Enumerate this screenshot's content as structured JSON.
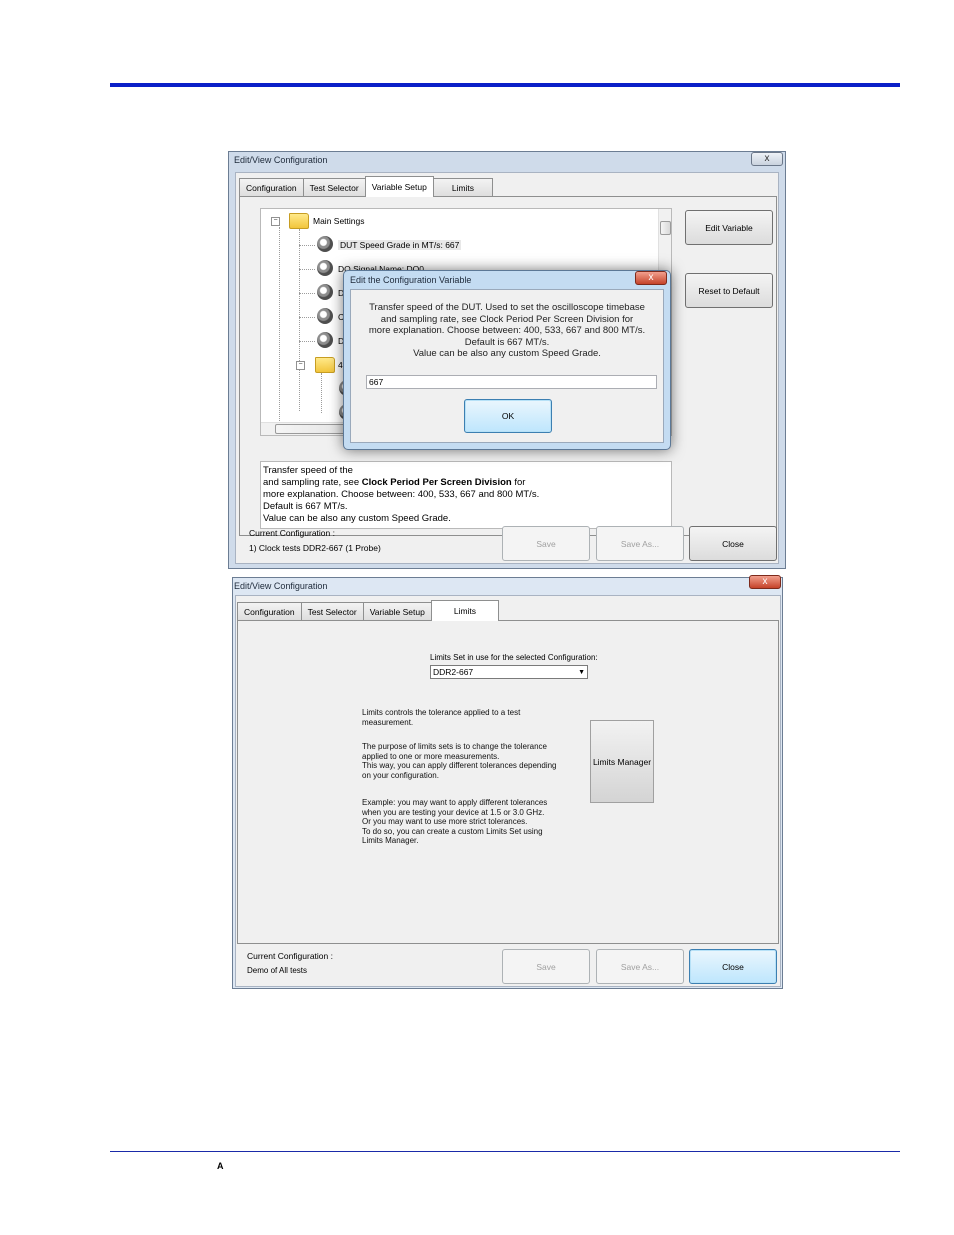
{
  "window1": {
    "title": "Edit/View Configuration",
    "tabs": [
      "Configuration",
      "Test Selector",
      "Variable Setup",
      "Limits"
    ],
    "tree": {
      "root": "Main Settings",
      "items": [
        "DUT Speed Grade in MT/s: 667",
        "DQ Signal Name: DQ0",
        "DQ",
        "Cl",
        "DU"
      ],
      "subfolder": "4th"
    },
    "description": {
      "line1_visible": "Transfer speed of the",
      "line2_prefix": "and sampling rate, see ",
      "line2_bold": "Clock Period Per Screen Division",
      "line2_suffix": " for",
      "line3": "more explanation. Choose between: 400, 533, 667 and 800 MT/s.",
      "line4": "Default is 667 MT/s.",
      "line5": "Value can be also any custom Speed Grade."
    },
    "buttons": {
      "edit_variable": "Edit Variable",
      "reset_default": "Reset to Default",
      "save": "Save",
      "save_as": "Save As...",
      "close": "Close"
    },
    "current_config_label": "Current Configuration :",
    "current_config_value": "1) Clock tests DDR2-667 (1 Probe)",
    "close_glyph": "x"
  },
  "dialog": {
    "title": "Edit the Configuration Variable",
    "message": [
      "Transfer speed of the DUT. Used to set the oscilloscope timebase",
      "and sampling rate, see Clock Period Per Screen Division for",
      "more explanation. Choose between: 400, 533, 667 and 800 MT/s.",
      "Default is 667 MT/s.",
      "Value can be also any custom Speed Grade."
    ],
    "input_value": "667",
    "ok_label": "OK",
    "close_glyph": "x"
  },
  "window2": {
    "title": "Edit/View Configuration",
    "tabs": [
      "Configuration",
      "Test Selector",
      "Variable Setup",
      "Limits"
    ],
    "limits_set_label": "Limits Set in use for the selected Configuration:",
    "limits_set_value": "DDR2-667",
    "paragraphs": [
      [
        "Limits controls the tolerance applied to a test",
        "measurement."
      ],
      [
        "The purpose of limits sets is to change the tolerance",
        "applied to one or more measurements.",
        "This way, you can apply different tolerances depending",
        "on your configuration."
      ],
      [
        "Example: you may want to apply different tolerances",
        "when you are testing your device at 1.5 or 3.0 GHz.",
        "Or you may want to use more strict tolerances.",
        "To do so, you can create a custom Limits Set using",
        "Limits Manager."
      ]
    ],
    "limits_manager_label": "Limits Manager",
    "buttons": {
      "save": "Save",
      "save_as": "Save As...",
      "close": "Close"
    },
    "current_config_label": "Current Configuration :",
    "current_config_value": "Demo of All tests",
    "close_glyph": "x"
  },
  "footer_mark": "A",
  "colors": {
    "header_bar": "#0a1fc8",
    "window_frame": "#cfdbea",
    "button_focus": "#bee6fd"
  }
}
